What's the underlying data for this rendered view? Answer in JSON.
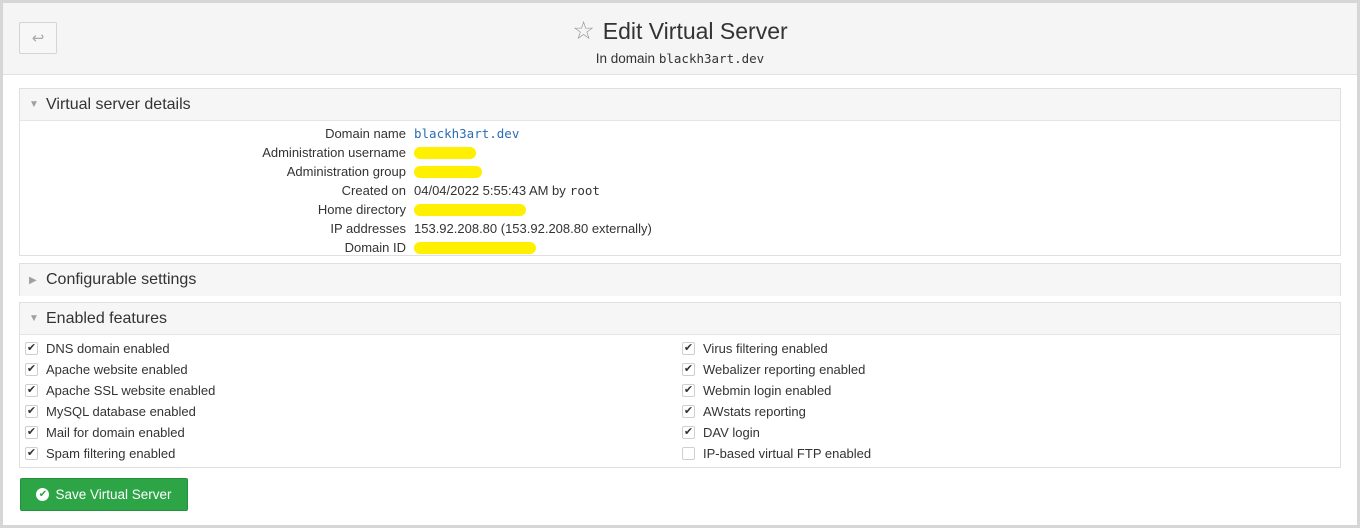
{
  "header": {
    "back_icon": "back-arrow-icon",
    "star_icon": "star-outline-icon",
    "title": "Edit Virtual Server",
    "subtitle_prefix": "In domain",
    "subtitle_domain": "blackh3art.dev"
  },
  "details": {
    "title": "Virtual server details",
    "rows": {
      "domain_name": {
        "label": "Domain name",
        "value": "blackh3art.dev"
      },
      "admin_username": {
        "label": "Administration username",
        "value": ""
      },
      "admin_group": {
        "label": "Administration group",
        "value": ""
      },
      "created_on": {
        "label": "Created on",
        "value": "04/04/2022 5:55:43 AM by",
        "user": "root"
      },
      "home_dir": {
        "label": "Home directory",
        "value": ""
      },
      "ip_addresses": {
        "label": "IP addresses",
        "value": "153.92.208.80 (153.92.208.80 externally)"
      },
      "domain_id": {
        "label": "Domain ID",
        "value": ""
      }
    }
  },
  "configurable": {
    "title": "Configurable settings"
  },
  "features": {
    "title": "Enabled features",
    "left": [
      {
        "label": "DNS domain enabled",
        "checked": true
      },
      {
        "label": "Apache website enabled",
        "checked": true
      },
      {
        "label": "Apache SSL website enabled",
        "checked": true
      },
      {
        "label": "MySQL database enabled",
        "checked": true
      },
      {
        "label": "Mail for domain enabled",
        "checked": true
      },
      {
        "label": "Spam filtering enabled",
        "checked": true
      }
    ],
    "right": [
      {
        "label": "Virus filtering enabled",
        "checked": true
      },
      {
        "label": "Webalizer reporting enabled",
        "checked": true
      },
      {
        "label": "Webmin login enabled",
        "checked": true
      },
      {
        "label": "AWstats reporting",
        "checked": true
      },
      {
        "label": "DAV login",
        "checked": true
      },
      {
        "label": "IP-based virtual FTP enabled",
        "checked": false
      }
    ]
  },
  "save_button": {
    "label": "Save Virtual Server"
  },
  "colors": {
    "accent_green": "#2da547",
    "link_blue": "#2a6db5",
    "redaction_yellow": "#ffef00"
  }
}
